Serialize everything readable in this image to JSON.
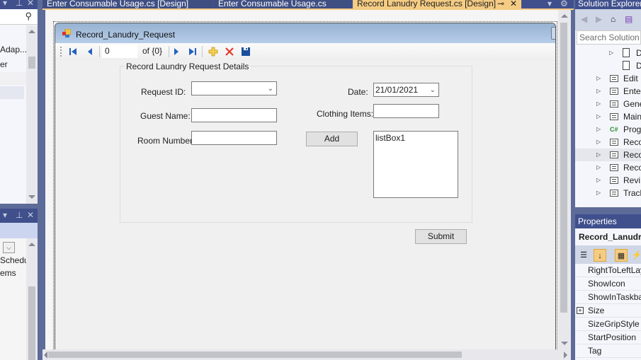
{
  "tabs": [
    {
      "label": "Enter Consumable Usage.cs [Design]",
      "active": false
    },
    {
      "label": "Enter Consumable Usage.cs",
      "active": false
    },
    {
      "label": "Record Lanudry Request.cs [Design]",
      "active": true
    }
  ],
  "tab_icons": {
    "pin": "⊸",
    "close": "✕",
    "dropdown": "▾",
    "settings": "⚙"
  },
  "left_panel_top": {
    "header_icons": {
      "dropdown": "▾",
      "pin": "⊥",
      "close": "✕"
    },
    "search_icon": "⚲",
    "items": [
      "Adap...",
      "er"
    ]
  },
  "left_panel_bottom": {
    "header_icons": {
      "dropdown": "▾",
      "pin": "⊥",
      "close": "✕"
    },
    "combo_chevron": "⌵",
    "items": [
      "Schedul",
      "ems"
    ]
  },
  "form": {
    "title": "Record_Lanudry_Request",
    "navigator": {
      "position": "0",
      "count_label": "of {0}"
    },
    "group_title": "Record Laundry Request Details",
    "labels": {
      "request_id": "Request ID:",
      "guest_name": "Guest Name:",
      "room_number": "Room Number:",
      "date": "Date:",
      "clothing_items": "Clothing Items:"
    },
    "values": {
      "request_id": "",
      "guest_name": "",
      "room_number": "",
      "date": "21/01/2021",
      "clothing_items": ""
    },
    "listbox_items": [
      "listBox1"
    ],
    "buttons": {
      "add": "Add",
      "submit": "Submit"
    }
  },
  "solution_explorer": {
    "title": "Solution Explorer",
    "search_placeholder": "Search Solution E",
    "items": [
      {
        "label": "D",
        "type": "doc",
        "expandable": true
      },
      {
        "label": "D",
        "type": "doc",
        "expandable": false
      },
      {
        "label": "Edit",
        "type": "form",
        "expandable": true
      },
      {
        "label": "Ente",
        "type": "form",
        "expandable": true
      },
      {
        "label": "Gene",
        "type": "form",
        "expandable": true
      },
      {
        "label": "Main",
        "type": "form",
        "expandable": true
      },
      {
        "label": "Prog",
        "type": "csharp",
        "expandable": true
      },
      {
        "label": "Reco",
        "type": "form",
        "expandable": true
      },
      {
        "label": "Reco",
        "type": "form",
        "expandable": true,
        "selected": true
      },
      {
        "label": "Reco",
        "type": "form",
        "expandable": true
      },
      {
        "label": "Revi",
        "type": "form",
        "expandable": true
      },
      {
        "label": "Track",
        "type": "form",
        "expandable": true
      }
    ]
  },
  "properties": {
    "title": "Properties",
    "object": "Record_Lanudry",
    "rows": [
      {
        "name": "RightToLeftLay",
        "expandable": false
      },
      {
        "name": "ShowIcon",
        "expandable": false
      },
      {
        "name": "ShowInTaskba",
        "expandable": false
      },
      {
        "name": "Size",
        "expandable": true
      },
      {
        "name": "SizeGripStyle",
        "expandable": false
      },
      {
        "name": "StartPosition",
        "expandable": false
      },
      {
        "name": "Tag",
        "expandable": false
      }
    ]
  }
}
